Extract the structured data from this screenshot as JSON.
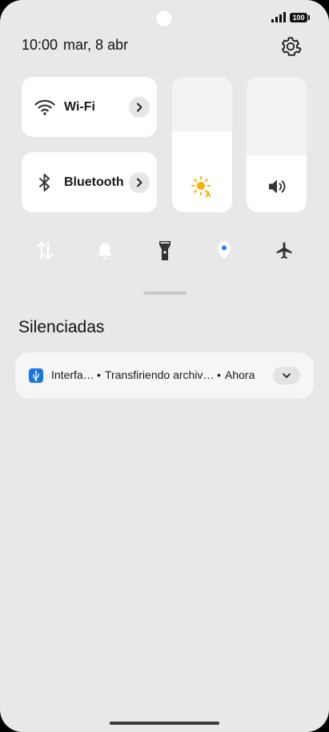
{
  "status_bar": {
    "battery": "100",
    "icons": [
      "signal-icon",
      "battery-icon"
    ]
  },
  "header": {
    "time": "10:00",
    "date": "mar, 8 abr",
    "settings_icon": "gear-icon"
  },
  "tiles": [
    {
      "label": "Wi-Fi",
      "icon": "wifi-icon",
      "chevron": "chevron-right-icon"
    },
    {
      "label": "Bluetooth",
      "icon": "bluetooth-icon",
      "chevron": "chevron-right-icon"
    }
  ],
  "sliders": {
    "brightness": {
      "icon": "auto-brightness-icon",
      "level": 0.6
    },
    "volume": {
      "icon": "volume-icon",
      "level": 0.42
    }
  },
  "quick_toggles": [
    {
      "name": "mobile-data-toggle",
      "icon": "data-transfer-icon",
      "state": "on"
    },
    {
      "name": "sound-toggle",
      "icon": "bell-icon",
      "state": "on"
    },
    {
      "name": "flashlight-toggle",
      "icon": "flashlight-icon",
      "state": "off"
    },
    {
      "name": "location-toggle",
      "icon": "location-icon",
      "state": "on"
    },
    {
      "name": "airplane-mode-toggle",
      "icon": "airplane-icon",
      "state": "off"
    }
  ],
  "section": {
    "title": "Silenciadas"
  },
  "notification": {
    "app": "Interfa…",
    "message": "Transfiriendo archiv…",
    "time": "Ahora",
    "icon": "usb-icon",
    "expand_icon": "chevron-down-icon"
  },
  "colors": {
    "accent": "#2f7af4",
    "background": "#e8e8e8",
    "tile": "#ffffff",
    "sun": "#f5b400"
  }
}
